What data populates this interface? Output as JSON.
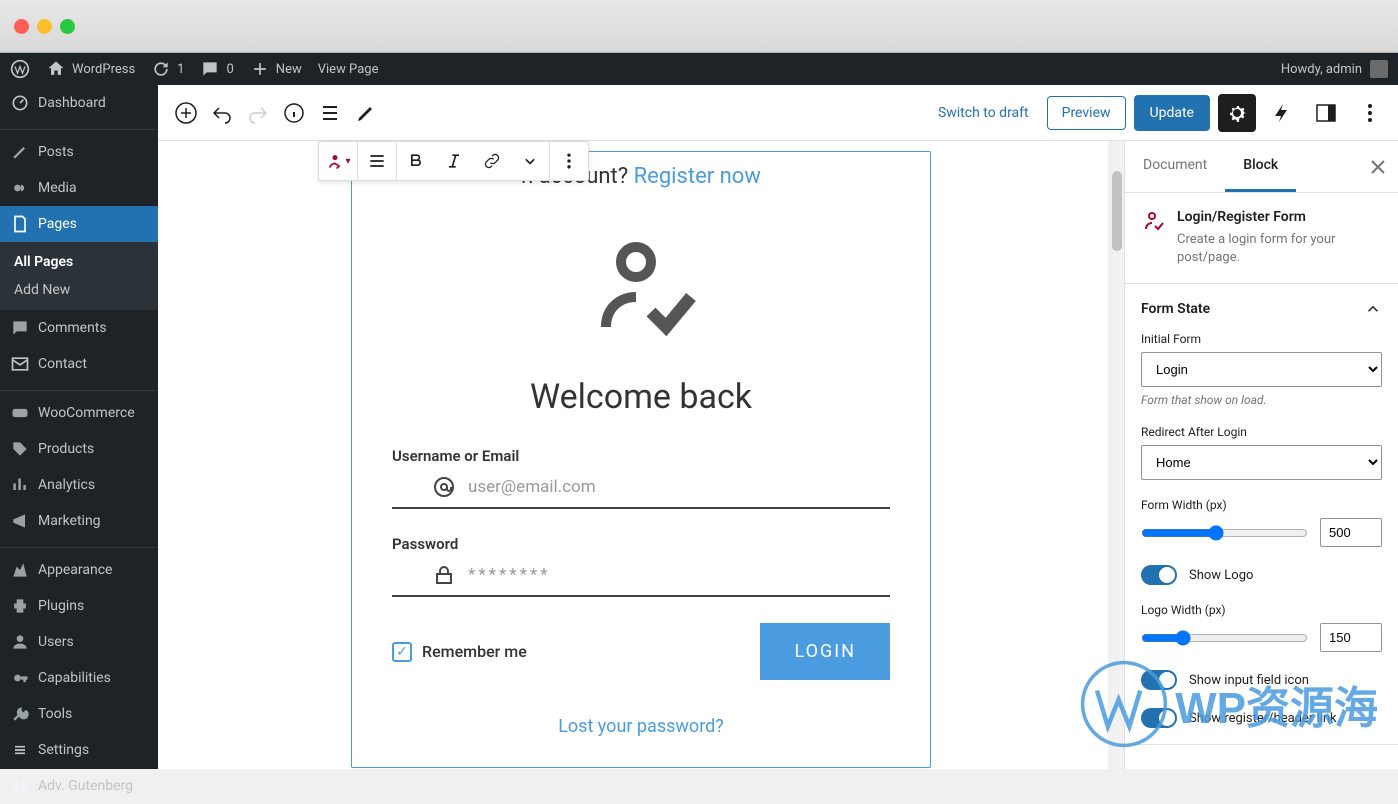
{
  "mac": {
    "title": ""
  },
  "adminbar": {
    "site": "WordPress",
    "updates": "1",
    "comments": "0",
    "new": "New",
    "viewpage": "View Page",
    "howdy": "Howdy, admin"
  },
  "sidebar": {
    "dashboard": "Dashboard",
    "posts": "Posts",
    "media": "Media",
    "pages": "Pages",
    "all_pages": "All Pages",
    "add_new": "Add New",
    "comments": "Comments",
    "contact": "Contact",
    "woocommerce": "WooCommerce",
    "products": "Products",
    "analytics": "Analytics",
    "marketing": "Marketing",
    "appearance": "Appearance",
    "plugins": "Plugins",
    "users": "Users",
    "capabilities": "Capabilities",
    "tools": "Tools",
    "settings": "Settings",
    "adv_gutenberg": "Adv. Gutenberg"
  },
  "editorbar": {
    "switch_draft": "Switch to draft",
    "preview": "Preview",
    "update": "Update"
  },
  "form": {
    "register_prompt_suffix": "n account? ",
    "register_link": "Register now",
    "welcome": "Welcome back",
    "username_label": "Username or Email",
    "username_placeholder": "user@email.com",
    "password_label": "Password",
    "password_placeholder": "********",
    "remember": "Remember me",
    "login_btn": "LOGIN",
    "lost_pw": "Lost your password?"
  },
  "inspector": {
    "tab_document": "Document",
    "tab_block": "Block",
    "block_title": "Login/Register Form",
    "block_desc": "Create a login form for your post/page.",
    "panel_form_state": "Form State",
    "initial_form_label": "Initial Form",
    "initial_form_value": "Login",
    "initial_form_help": "Form that show on load.",
    "redirect_label": "Redirect After Login",
    "redirect_value": "Home",
    "form_width_label": "Form Width (px)",
    "form_width_value": "500",
    "show_logo": "Show Logo",
    "logo_width_label": "Logo Width (px)",
    "logo_width_value": "150",
    "show_input_icon": "Show input field icon",
    "show_register_link": "Show register/header link"
  },
  "watermark": {
    "text": "WP资源海"
  }
}
